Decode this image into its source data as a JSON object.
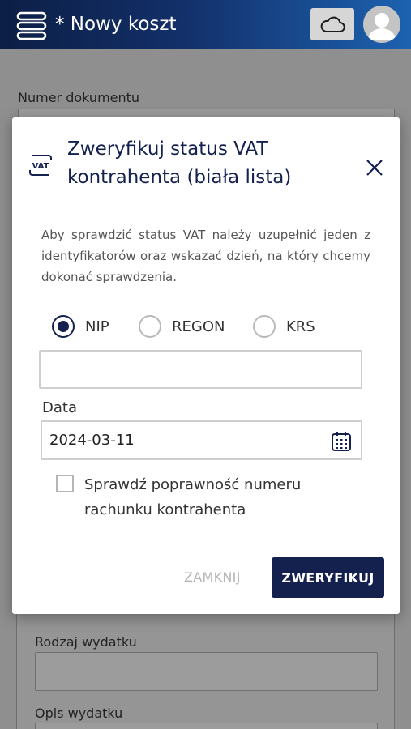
{
  "header": {
    "title": "* Nowy koszt",
    "menu_icon": "menu-stack-icon",
    "cloud_icon": "cloud-icon",
    "avatar_icon": "user-avatar-icon"
  },
  "background": {
    "field_document_number_label": "Numer dokumentu",
    "field_expense_type_label": "Rodzaj wydatku",
    "field_expense_description_label": "Opis wydatku"
  },
  "modal": {
    "title": "Zweryfikuj status VAT kontrahenta (biała lista)",
    "vat_icon_text": "VAT",
    "description": "Aby sprawdzić status VAT należy uzupełnić jeden z identyfikatorów oraz wskazać dzień, na który chcemy dokonać sprawdzenia.",
    "radios": [
      {
        "label": "NIP",
        "checked": true
      },
      {
        "label": "REGON",
        "checked": false
      },
      {
        "label": "KRS",
        "checked": false
      }
    ],
    "identifier_value": "",
    "date_label": "Data",
    "date_value": "2024-03-11",
    "checkbox_label": "Sprawdź poprawność numeru rachunku kontrahenta",
    "checkbox_checked": false,
    "close_label": "ZAMKNIJ",
    "verify_label": "ZWERYFIKUJ"
  },
  "colors": {
    "primary": "#14214f",
    "header_gradient_end": "#1d62b0"
  }
}
